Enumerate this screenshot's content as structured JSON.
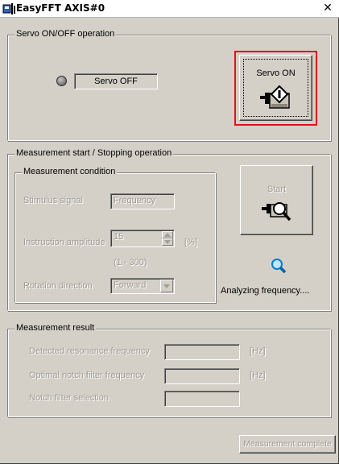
{
  "window": {
    "title": "EasyFFT AXIS#0",
    "close_symbol": "✕"
  },
  "servo_group": {
    "label": "Servo ON/OFF operation",
    "status_text": "Servo OFF",
    "servo_on_button": "Servo ON"
  },
  "measure_group": {
    "label": "Measurement start / Stopping operation",
    "condition": {
      "label": "Measurement condition",
      "stimulus_label": "Stimulus signal",
      "stimulus_value": "Frequency",
      "amplitude_label": "Instruction amplitude",
      "amplitude_value": "15",
      "amplitude_unit": "[%]",
      "amplitude_range": "(1 - 300)",
      "rotation_label": "Rotation direction",
      "rotation_value": "Forward"
    },
    "start_button": "Start",
    "analyzing_text": "Analyzing frequency...."
  },
  "result_group": {
    "label": "Measurement result",
    "resonance_label": "Detected resonance frequency",
    "resonance_value": "",
    "resonance_unit": "[Hz]",
    "notch_freq_label": "Optimal notch filter frequency",
    "notch_freq_value": "",
    "notch_freq_unit": "[Hz]",
    "notch_sel_label": "Notch filter selection",
    "notch_sel_value": ""
  },
  "footer": {
    "complete_button": "Measurement complete"
  },
  "icons": {
    "title": "app-icon",
    "servo": "servo-motor-icon",
    "start": "motor-magnifier-icon",
    "analyzing": "magnifier-icon"
  },
  "colors": {
    "highlight": "#e0101a",
    "window_bg": "#d4d0c8"
  }
}
